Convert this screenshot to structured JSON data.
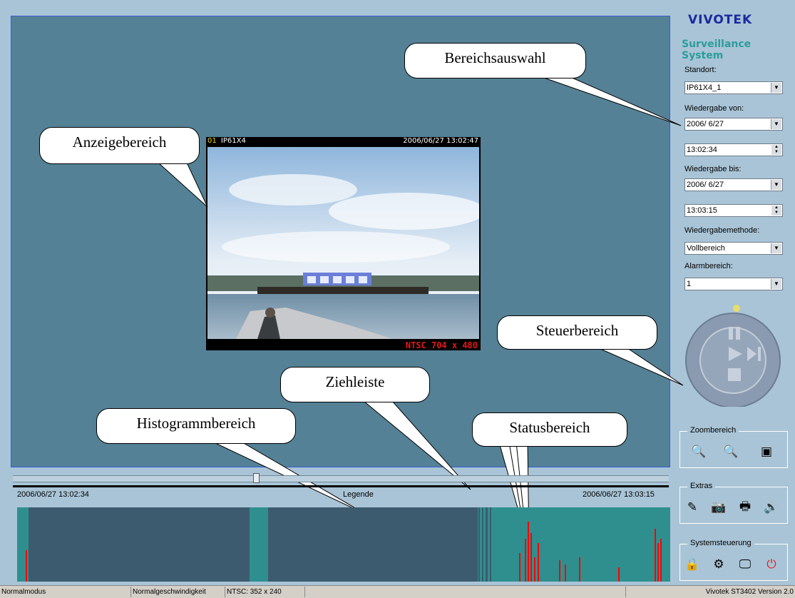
{
  "display": {
    "cam_number": "01",
    "cam_name": "IP61X4",
    "timestamp": "2006/06/27 13:02:47",
    "resolution": "NTSC 704 x 480"
  },
  "callouts": {
    "bereichsauswahl": "Bereichsauswahl",
    "anzeigebereich": "Anzeigebereich",
    "steuerbereich": "Steuerbereich",
    "ziehleiste": "Ziehleiste",
    "histogrammbereich": "Histogrammbereich",
    "statusbereich": "Statusbereich"
  },
  "brand": {
    "logo": "VIVOTEK",
    "subtitle": "Surveillance System"
  },
  "selection": {
    "standort_label": "Standort:",
    "standort_value": "IP61X4_1",
    "von_label": "Wiedergabe von:",
    "von_date": "2006/ 6/27",
    "von_time": "13:02:34",
    "bis_label": "Wiedergabe bis:",
    "bis_date": "2006/ 6/27",
    "bis_time": "13:03:15",
    "methode_label": "Wiedergabemethode:",
    "methode_value": "Vollbereich",
    "alarm_label": "Alarmbereich:",
    "alarm_value": "1"
  },
  "groups": {
    "zoom": "Zoombereich",
    "extras": "Extras",
    "system": "Systemsteuerung"
  },
  "timeline": {
    "start": "2006/06/27 13:02:34",
    "end": "2006/06/27 13:03:15",
    "legend": "Legende",
    "position": 0.37
  },
  "status": {
    "mode": "Normalmodus",
    "speed": "Normalgeschwindigkeit",
    "format": "NTSC: 352 x 240",
    "version": "Vivotek ST3402   Version 2.0"
  },
  "colors": {
    "accent": "#548196",
    "histogram_teal": "#2f8f8f",
    "histogram_dark": "#3d5b6e",
    "alarm": "#ff0000"
  }
}
